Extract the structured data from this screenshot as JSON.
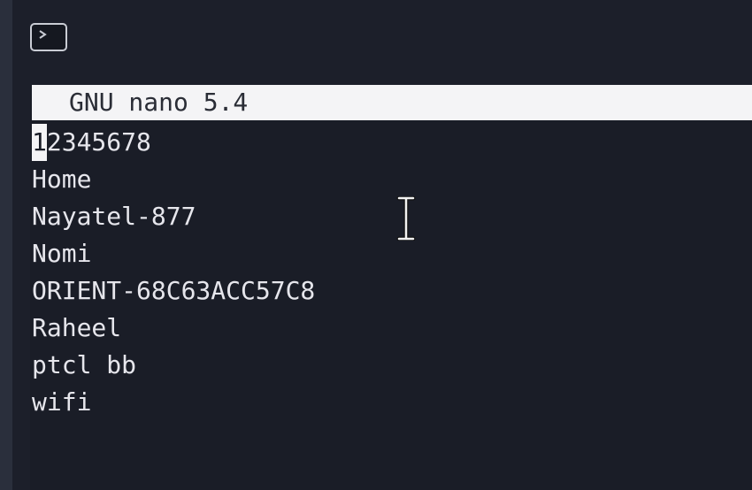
{
  "window": {
    "icon": "terminal-icon",
    "colors": {
      "background": "#1c1f2a",
      "header_bg": "#f4f4f6",
      "text": "#e6e6ec"
    }
  },
  "nano": {
    "header": "GNU nano 5.4",
    "cursor_char": "1",
    "first_line_rest": "2345678",
    "lines": [
      "Home",
      "Nayatel-877",
      "Nomi",
      "ORIENT-68C63ACC57C8",
      "Raheel",
      "ptcl bb",
      "wifi"
    ]
  },
  "pointer": {
    "icon": "text-cursor-ibeam-icon"
  }
}
